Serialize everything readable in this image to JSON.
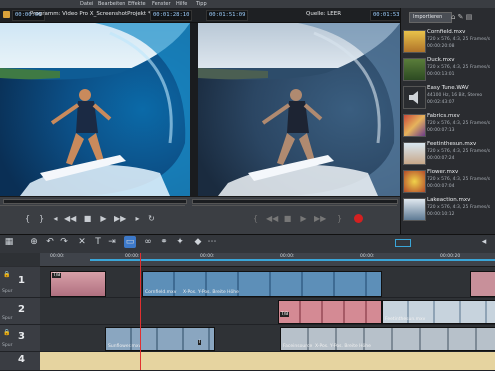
{
  "menubar": {
    "items": [
      "Datei",
      "Bearbeiten",
      "Effekte",
      "Fenster",
      "Hilfe",
      "Tipp"
    ]
  },
  "program_monitor": {
    "title": "Programm: Video Pro X_ScreenshotProjekt *",
    "timecode_left": "00:00:00",
    "timecode_right": "00:01:28:10"
  },
  "source_monitor": {
    "timecode_left": "00:01:51:09",
    "title": "Quelle: LEER",
    "timecode_right": "00:01:53:07"
  },
  "importer": {
    "tab": "Importieren",
    "items": [
      {
        "name": "Cornfield.mxv",
        "info": "720 x 576, 4:3, 25 Frames/s",
        "time": "00:00:20:08"
      },
      {
        "name": "Duck.mxv",
        "info": "720 x 576, 4:3, 25 Frames/s",
        "time": "00:00:13:01"
      },
      {
        "name": "Easy Tune.WAV",
        "info": "44100 Hz, 16 Bit, Stereo",
        "time": "00:02:43:07"
      },
      {
        "name": "Fabrics.mxv",
        "info": "720 x 576, 4:3, 25 Frames/s",
        "time": "00:00:07:13"
      },
      {
        "name": "Feetinthesun.mxv",
        "info": "720 x 576, 4:3, 25 Frames/s",
        "time": "00:00:07:24"
      },
      {
        "name": "Flower.mxv",
        "info": "720 x 576, 4:3, 25 Frames/s",
        "time": "00:00:07:04"
      },
      {
        "name": "Lakeaction.mxv",
        "info": "720 x 576, 4:3, 25 Frames/s",
        "time": "00:00:10:12"
      }
    ]
  },
  "ruler": {
    "labels": [
      "00:00:",
      "00:00:",
      "00:00:",
      "00:00:",
      "00:00:",
      "00:00:20"
    ]
  },
  "tracks": [
    {
      "number": "1",
      "label": "Spur"
    },
    {
      "number": "2",
      "label": "Spur"
    },
    {
      "number": "3",
      "label": "Spur"
    },
    {
      "number": "4",
      "label": ""
    }
  ],
  "clips": {
    "t1a": {
      "name": "Cornfield.mxv",
      "fx": "",
      "tail": "X-Pos.  Y-Pos.  Breite  Höhe"
    },
    "t1a_fx": "T/B",
    "t2a_fx": "T/B",
    "t2b": {
      "name": "Feetinthesun.mxv"
    },
    "t3a": {
      "name": "Sunflower.mxv"
    },
    "t3a_fx": "I",
    "t3b": {
      "name": "Faceinsource",
      "tail": "X-Pos.  Y-Pos.  Breite  Höhe"
    }
  }
}
